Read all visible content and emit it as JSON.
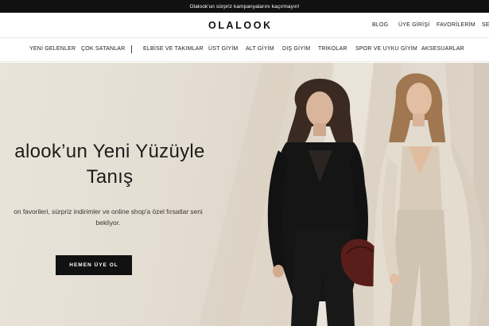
{
  "announcement": "Olalook'un sürpriz kampanyalarını kaçırmayın!",
  "header": {
    "logo": "OLALOOK",
    "links": [
      "BLOG",
      "ÜYE GİRİŞİ",
      "FAVORİLERİM",
      "SE"
    ]
  },
  "nav": {
    "items": [
      "YENİ GELENLER",
      "ÇOK SATANLAR",
      "ELBİSE VE TAKIMLAR",
      "ÜST GİYİM",
      "ALT GİYİM",
      "DIŞ GİYİM",
      "TRİKOLAR",
      "SPOR VE UYKU GİYİM",
      "AKSESUARLAR"
    ]
  },
  "hero": {
    "title_line1": "alook’un Yeni Yüzüyle",
    "title_line2": "Tanış",
    "subtitle_line1": "on favorileri, sürpriz indirimler ve online shop'a özel fırsatlar seni",
    "subtitle_line2": "bekliyor.",
    "cta": "HEMEN ÜYE OL"
  },
  "colors": {
    "topbar": "#111111",
    "button": "#111111",
    "hero_bg": "#e4ddd2"
  }
}
